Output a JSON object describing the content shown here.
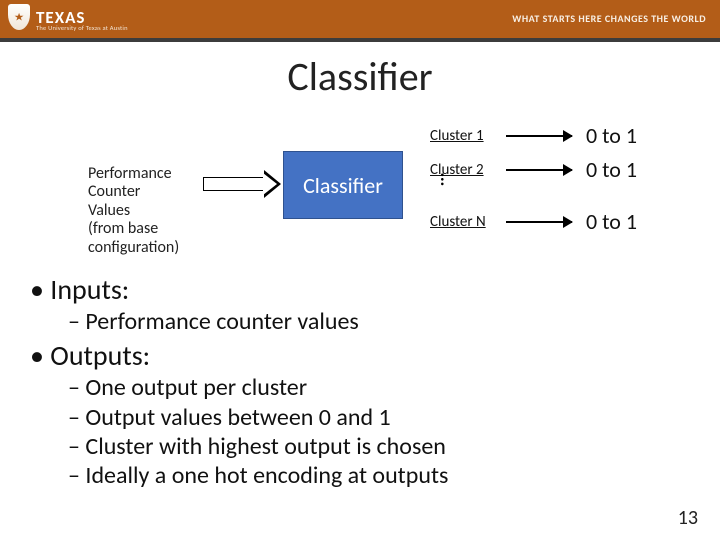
{
  "header": {
    "logo_text": "TEXAS",
    "subline": "The University of Texas at Austin",
    "tagline": "WHAT STARTS HERE CHANGES THE WORLD"
  },
  "title": "Classifier",
  "diagram": {
    "input_label": "Performance\nCounter\nValues\n(from base\nconfiguration)",
    "box_label": "Classifier",
    "outputs": [
      {
        "label": "Cluster 1",
        "range": "0 to 1"
      },
      {
        "label": "Cluster 2",
        "range": "0 to 1"
      },
      {
        "label": "Cluster N",
        "range": "0 to 1"
      }
    ],
    "ellipsis": "..."
  },
  "bullets": {
    "inputs_head": "Inputs:",
    "inputs_sub1": "Performance counter values",
    "outputs_head": "Outputs:",
    "out_sub1": "One output per cluster",
    "out_sub2": "Output values between 0 and 1",
    "out_sub3": "Cluster with highest output is chosen",
    "out_sub4": "Ideally a one hot encoding at outputs"
  },
  "page_number": "13"
}
